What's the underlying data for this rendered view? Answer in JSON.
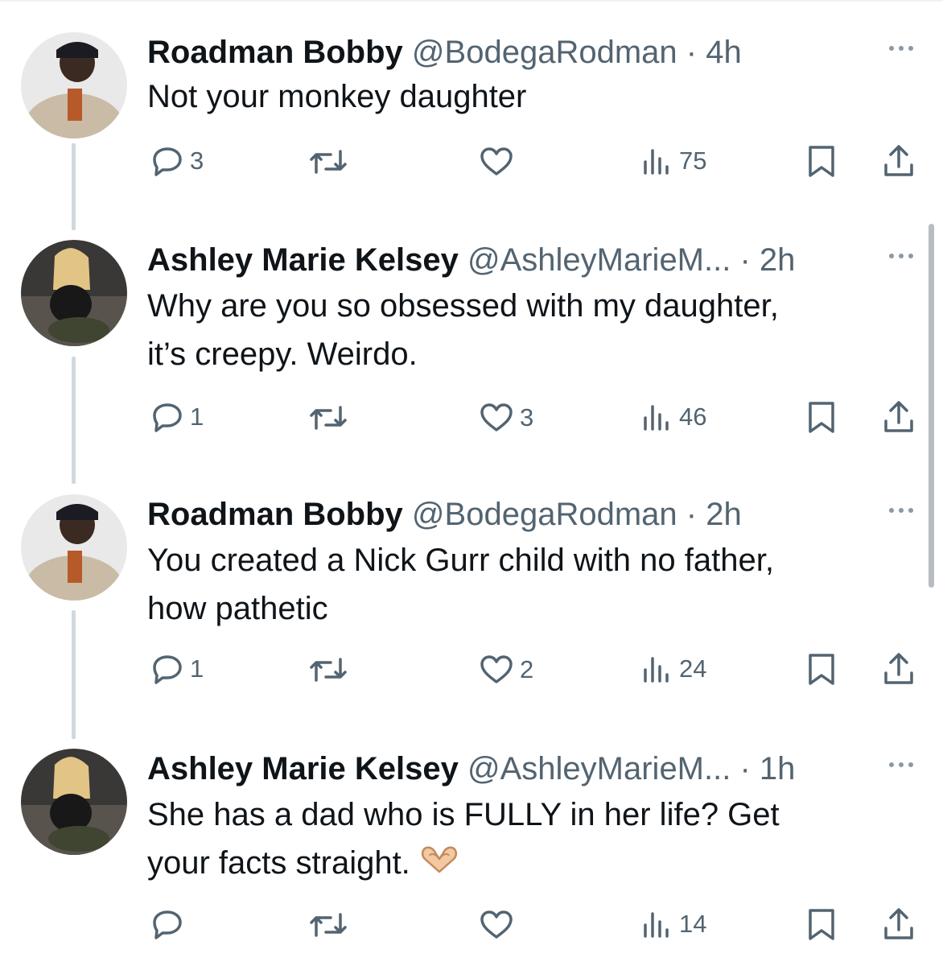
{
  "tweets": [
    {
      "name": "Roadman Bobby",
      "handle": "@BodegaRodman",
      "dot": "·",
      "time": "4h",
      "lines": [
        "Not your monkey daughter"
      ],
      "replies": "3",
      "retweets": "",
      "likes": "",
      "views": "75"
    },
    {
      "name": "Ashley Marie Kelsey",
      "handle": "@AshleyMarieM...",
      "dot": "·",
      "time": "2h",
      "lines": [
        "Why are you so obsessed with my daughter,",
        "it’s creepy. Weirdo."
      ],
      "replies": "1",
      "retweets": "",
      "likes": "3",
      "views": "46"
    },
    {
      "name": "Roadman Bobby",
      "handle": "@BodegaRodman",
      "dot": "·",
      "time": "2h",
      "lines": [
        "You created a Nick Gurr child with no father,",
        "how pathetic"
      ],
      "replies": "1",
      "retweets": "",
      "likes": "2",
      "views": "24"
    },
    {
      "name": "Ashley Marie Kelsey",
      "handle": "@AshleyMarieM...",
      "dot": "·",
      "time": "1h",
      "lines": [
        "She has a dad who is FULLY in her life? Get",
        "your facts straight."
      ],
      "emoji": "heart-hands-emoji",
      "replies": "",
      "retweets": "",
      "likes": "",
      "views": "14"
    }
  ],
  "icons": {
    "reply": "reply-icon",
    "retweet": "retweet-icon",
    "like": "heart-icon",
    "views": "views-icon",
    "bookmark": "bookmark-icon",
    "share": "share-icon",
    "more": "more-icon"
  },
  "colors": {
    "text": "#0f1419",
    "secondary": "#536471",
    "thread_line": "#cfd9de"
  }
}
